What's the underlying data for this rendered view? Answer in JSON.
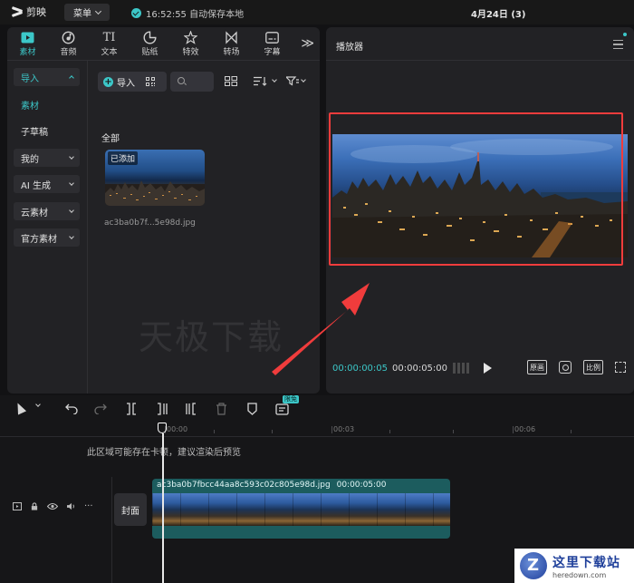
{
  "topbar": {
    "app_name": "剪映",
    "menu_label": "菜单",
    "autosave_text": "16:52:55 自动保存本地",
    "document_title": "4月24日 (3)"
  },
  "media_panel": {
    "tabs": [
      {
        "label": "素材",
        "icon": "media-icon",
        "active": true
      },
      {
        "label": "音频",
        "icon": "audio-icon"
      },
      {
        "label": "文本",
        "icon": "text-icon",
        "glyph": "TI"
      },
      {
        "label": "贴纸",
        "icon": "sticker-icon"
      },
      {
        "label": "特效",
        "icon": "effects-icon"
      },
      {
        "label": "转场",
        "icon": "transition-icon"
      },
      {
        "label": "字幕",
        "icon": "subtitle-icon"
      }
    ],
    "more_glyph": "≫",
    "side_nav": [
      {
        "label": "导入",
        "style": "boxed-selected"
      },
      {
        "label": "素材",
        "style": "selected-plain"
      },
      {
        "label": "子草稿",
        "style": "plain"
      },
      {
        "label": "我的",
        "style": "boxed"
      },
      {
        "label": "AI 生成",
        "style": "boxed"
      },
      {
        "label": "云素材",
        "style": "boxed"
      },
      {
        "label": "官方素材",
        "style": "boxed"
      }
    ],
    "import_button": "导入",
    "search_placeholder": "",
    "section_label": "全部",
    "media_item": {
      "badge": "已添加",
      "file_name": "ac3ba0b7f...5e98d.jpg"
    },
    "watermark": "天极下载"
  },
  "player": {
    "title": "播放器",
    "current_time": "00:00:00:05",
    "total_time": "00:00:05:00",
    "btn_original": "原画",
    "btn_ratio": "比例"
  },
  "timeline": {
    "free_badge": "限免",
    "ruler_labels": [
      "00:00",
      "00:03",
      "00:06"
    ],
    "notice": "此区域可能存在卡顿，建议渲染后预览",
    "cover_label": "封面",
    "clip_name": "ac3ba0b7fbcc44aa8c593c02c805e98d.jpg",
    "clip_duration": "00:00:05:00"
  },
  "site_logo": {
    "cn": "这里下载站",
    "en": "heredown.com"
  },
  "colors": {
    "accent": "#3cc7c8",
    "highlight_red": "#f03c3c",
    "clip_teal": "#1c5c5e"
  }
}
